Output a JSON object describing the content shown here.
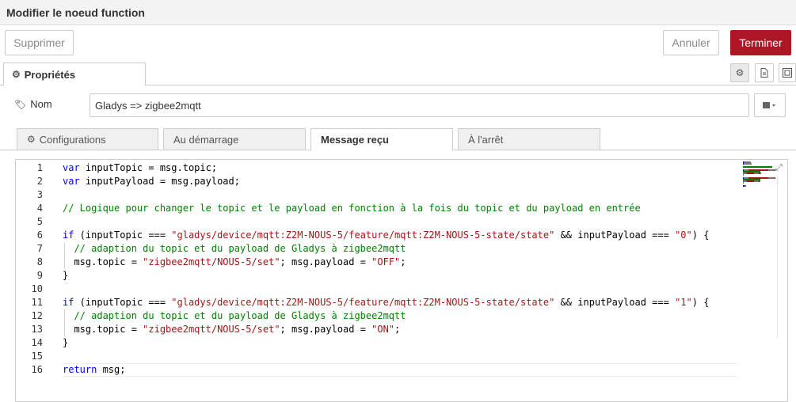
{
  "window": {
    "title": "Modifier le noeud function"
  },
  "toolbar": {
    "delete_label": "Supprimer",
    "cancel_label": "Annuler",
    "done_label": "Terminer"
  },
  "tabs": {
    "properties_label": "Propriétés"
  },
  "icons": {
    "settings": "gear-icon",
    "description": "document-icon",
    "appearance": "layout-icon",
    "name_tag": "tag-icon",
    "library": "book-icon"
  },
  "form": {
    "name_label": "Nom",
    "name_value": "Gladys => zigbee2mqtt"
  },
  "subtabs": [
    {
      "label": "Configurations"
    },
    {
      "label": "Au démarrage"
    },
    {
      "label": "Message reçu"
    },
    {
      "label": "À l'arrêt"
    }
  ],
  "code": {
    "line_numbers": [
      "1",
      "2",
      "3",
      "4",
      "5",
      "6",
      "7",
      "8",
      "9",
      "10",
      "11",
      "12",
      "13",
      "14",
      "15",
      "16"
    ],
    "lines": [
      [
        {
          "t": "var",
          "c": "kw"
        },
        {
          "t": " inputTopic = msg.topic;",
          "c": ""
        }
      ],
      [
        {
          "t": "var",
          "c": "kw"
        },
        {
          "t": " inputPayload = msg.payload;",
          "c": ""
        }
      ],
      [],
      [
        {
          "t": "// Logique pour changer le topic et le payload en fonction à la fois du topic et du payload en entrée",
          "c": "cmt"
        }
      ],
      [],
      [
        {
          "t": "if",
          "c": "kw"
        },
        {
          "t": " (inputTopic === ",
          "c": ""
        },
        {
          "t": "\"gladys/device/mqtt:Z2M-NOUS-5/feature/mqtt:Z2M-NOUS-5-state/state\"",
          "c": "str"
        },
        {
          "t": " && inputPayload === ",
          "c": ""
        },
        {
          "t": "\"0\"",
          "c": "str"
        },
        {
          "t": ") {",
          "c": ""
        }
      ],
      [
        {
          "t": "  // adaption du topic et du payload de Gladys à zigbee2mqtt",
          "c": "cmt"
        }
      ],
      [
        {
          "t": "  msg.topic = ",
          "c": ""
        },
        {
          "t": "\"zigbee2mqtt/NOUS-5/set\"",
          "c": "str"
        },
        {
          "t": "; msg.payload = ",
          "c": ""
        },
        {
          "t": "\"OFF\"",
          "c": "str"
        },
        {
          "t": ";",
          "c": ""
        }
      ],
      [
        {
          "t": "}",
          "c": ""
        }
      ],
      [],
      [
        {
          "t": "if",
          "c": "kw"
        },
        {
          "t": " (inputTopic === ",
          "c": ""
        },
        {
          "t": "\"gladys/device/mqtt:Z2M-NOUS-5/feature/mqtt:Z2M-NOUS-5-state/state\"",
          "c": "str"
        },
        {
          "t": " && inputPayload === ",
          "c": ""
        },
        {
          "t": "\"1\"",
          "c": "str"
        },
        {
          "t": ") {",
          "c": ""
        }
      ],
      [
        {
          "t": "  // adaption du topic et du payload de Gladys à zigbee2mqtt",
          "c": "cmt"
        }
      ],
      [
        {
          "t": "  msg.topic = ",
          "c": ""
        },
        {
          "t": "\"zigbee2mqtt/NOUS-5/set\"",
          "c": "str"
        },
        {
          "t": "; msg.payload = ",
          "c": ""
        },
        {
          "t": "\"ON\"",
          "c": "str"
        },
        {
          "t": ";",
          "c": ""
        }
      ],
      [
        {
          "t": "}",
          "c": ""
        }
      ],
      [],
      [
        {
          "t": "return",
          "c": "kw"
        },
        {
          "t": " msg;",
          "c": ""
        }
      ]
    ],
    "active_line": 16
  }
}
